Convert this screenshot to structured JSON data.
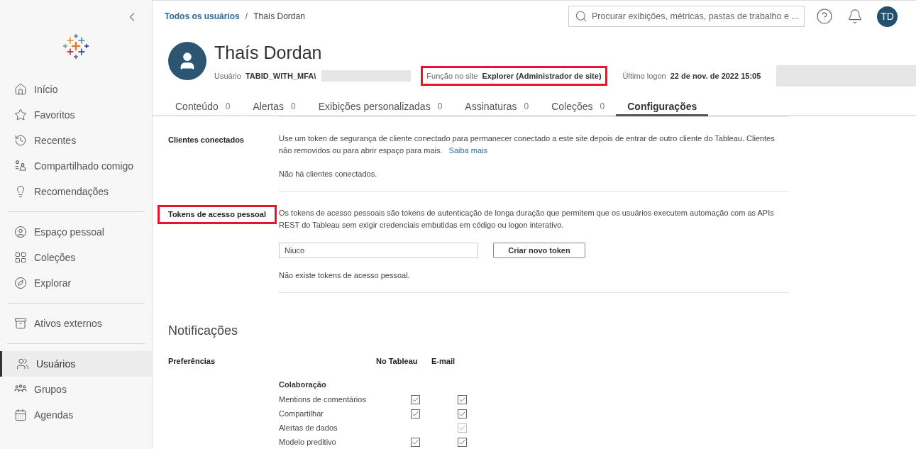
{
  "sidebar": {
    "groups": [
      {
        "items": [
          {
            "label": "Início",
            "selected": false
          },
          {
            "label": "Favoritos",
            "selected": false
          },
          {
            "label": "Recentes",
            "selected": false
          },
          {
            "label": "Compartilhado comigo",
            "selected": false
          },
          {
            "label": "Recomendações",
            "selected": false
          }
        ]
      },
      {
        "items": [
          {
            "label": "Espaço pessoal",
            "selected": false
          },
          {
            "label": "Coleções",
            "selected": false
          },
          {
            "label": "Explorar",
            "selected": false
          }
        ]
      },
      {
        "items": [
          {
            "label": "Ativos externos",
            "selected": false
          }
        ]
      },
      {
        "items": [
          {
            "label": "Usuários",
            "selected": true
          },
          {
            "label": "Grupos",
            "selected": false
          },
          {
            "label": "Agendas",
            "selected": false
          }
        ]
      }
    ]
  },
  "breadcrumb": {
    "link": "Todos os usuários",
    "separator": "/",
    "current": "Thaís Dordan"
  },
  "search": {
    "placeholder": "Procurar exibições, métricas, pastas de trabalho e ..."
  },
  "avatar_initials": "TD",
  "profile": {
    "name": "Thaís Dordan",
    "fields": [
      {
        "label": "Usuário",
        "value": "TABID_WITH_MFA\\",
        "highlighted": false,
        "redacted": true
      },
      {
        "label": "Função no site",
        "value": "Explorer (Administrador de site)",
        "highlighted": true,
        "redacted": false
      },
      {
        "label": "Último logon",
        "value": "22 de nov. de 2022 15:05",
        "highlighted": false,
        "redacted": true
      }
    ]
  },
  "tabs": [
    {
      "label": "Conteúdo",
      "count": "0",
      "selected": false
    },
    {
      "label": "Alertas",
      "count": "0",
      "selected": false
    },
    {
      "label": "Exibições personalizadas",
      "count": "0",
      "selected": false
    },
    {
      "label": "Assinaturas",
      "count": "0",
      "selected": false
    },
    {
      "label": "Coleções",
      "count": "0",
      "selected": false
    },
    {
      "label": "Configurações",
      "selected": true
    }
  ],
  "settings": [
    {
      "title": "Clientes conectados",
      "highlighted": false,
      "description": "Use um token de segurança de cliente conectado para permanecer conectado a este site depois de entrar de outro cliente do Tableau. Clientes não removidos ou para abrir espaço para mais.",
      "link": "Saiba mais",
      "empty": "Não há clientes conectados."
    },
    {
      "title": "Tokens de acesso pessoal",
      "highlighted": true,
      "description": "Os tokens de acesso pessoais são tokens de autenticação de longa duração que permitem que os usuários executem automação com as APIs REST do Tableau sem exigir credenciais embutidas em código ou logon interativo.",
      "token_name": "Niuco",
      "button": "Criar novo token",
      "empty": "Não existe tokens de acesso pessoal."
    }
  ],
  "notifications": {
    "title": "Notificações",
    "preferences_label": "Preferências",
    "columns": [
      "No Tableau",
      "E-mail"
    ],
    "group": "Colaboração",
    "rows": [
      {
        "label": "Mentions de comentários",
        "in_tableau": {
          "checked": true,
          "disabled": false
        },
        "email": {
          "checked": true,
          "disabled": false
        }
      },
      {
        "label": "Compartilhar",
        "in_tableau": {
          "checked": true,
          "disabled": false
        },
        "email": {
          "checked": true,
          "disabled": false
        }
      },
      {
        "label": "Alertas de dados",
        "email": {
          "checked": true,
          "disabled": true
        }
      },
      {
        "label": "Modelo preditivo",
        "in_tableau": {
          "checked": true,
          "disabled": false
        },
        "email": {
          "checked": true,
          "disabled": false
        }
      }
    ]
  }
}
